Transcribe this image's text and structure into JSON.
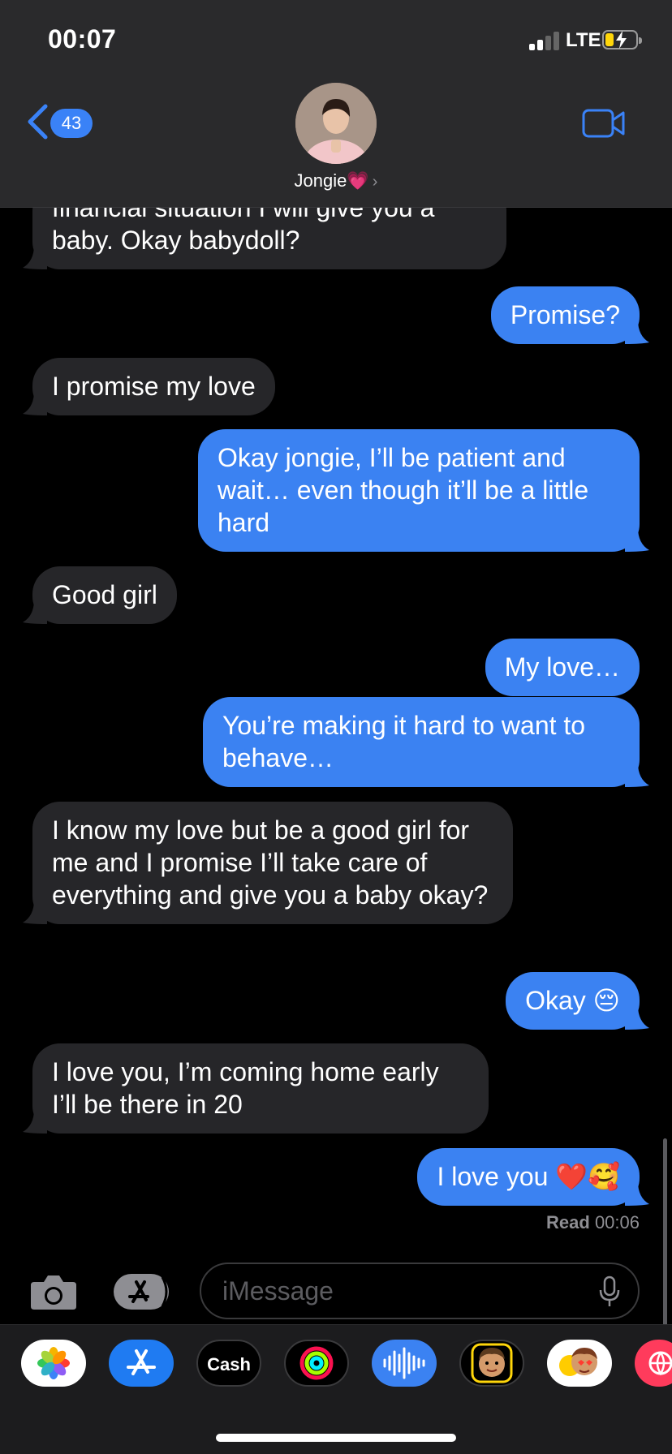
{
  "status": {
    "time": "00:07",
    "network": "LTE"
  },
  "header": {
    "back_count": "43",
    "contact_name": "Jongie",
    "contact_emoji": "💗",
    "chevron": "›"
  },
  "messages": [
    {
      "dir": "in",
      "text": "financial situation I will give you a baby. Okay babydoll?"
    },
    {
      "dir": "out",
      "text": "Promise?"
    },
    {
      "dir": "in",
      "text": "I promise my love"
    },
    {
      "dir": "out",
      "text": "Okay jongie, I’ll be patient and wait… even though it’ll be a little hard"
    },
    {
      "dir": "in",
      "text": "Good girl"
    },
    {
      "dir": "out",
      "text": "My love…"
    },
    {
      "dir": "out",
      "text": "You’re making it hard to want to behave…"
    },
    {
      "dir": "in",
      "text": "I know my love but be a good girl for me and I promise I’ll take care of everything and give you a baby okay?"
    },
    {
      "dir": "out",
      "text": "Okay 😔"
    },
    {
      "dir": "in",
      "text": "I love you, I’m coming home early I’ll be there in 20"
    },
    {
      "dir": "out",
      "text": "I love you ❤️🥰"
    }
  ],
  "read_receipt": {
    "label": "Read",
    "time": "00:06"
  },
  "composer": {
    "placeholder": "iMessage"
  },
  "drawer": {
    "apps": [
      {
        "name": "photos-app",
        "label": ""
      },
      {
        "name": "app-store-app",
        "label": ""
      },
      {
        "name": "apple-cash-app",
        "label": "Cash"
      },
      {
        "name": "fitness-app",
        "label": ""
      },
      {
        "name": "audio-message-app",
        "label": ""
      },
      {
        "name": "memoji-app",
        "label": ""
      },
      {
        "name": "memoji-stickers-app",
        "label": ""
      },
      {
        "name": "web-app",
        "label": ""
      }
    ]
  },
  "colors": {
    "incoming": "#262629",
    "outgoing": "#3b82f2",
    "accent": "#3a82f7"
  }
}
